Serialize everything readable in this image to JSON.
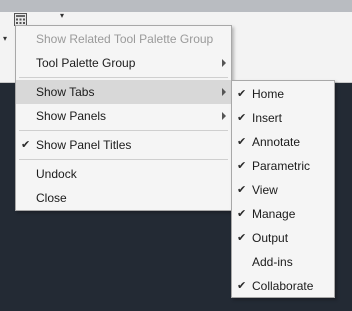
{
  "main_menu": {
    "items": [
      {
        "label": "Show Related Tool Palette Group",
        "disabled": true
      },
      {
        "label": "Tool Palette Group",
        "submenu": true
      },
      {
        "label": "Show Tabs",
        "submenu": true,
        "highlighted": true
      },
      {
        "label": "Show Panels",
        "submenu": true
      },
      {
        "label": "Show Panel Titles",
        "checked": true,
        "check": "✔"
      },
      {
        "label": "Undock"
      },
      {
        "label": "Close"
      }
    ]
  },
  "tabs_submenu": {
    "check_glyph": "✔",
    "items": [
      {
        "label": "Home",
        "checked": true
      },
      {
        "label": "Insert",
        "checked": true
      },
      {
        "label": "Annotate",
        "checked": true
      },
      {
        "label": "Parametric",
        "checked": true
      },
      {
        "label": "View",
        "checked": true
      },
      {
        "label": "Manage",
        "checked": true
      },
      {
        "label": "Output",
        "checked": true
      },
      {
        "label": "Add-ins",
        "checked": false
      },
      {
        "label": "Collaborate",
        "checked": true
      }
    ]
  },
  "colors": {
    "drawing_area": "#232a34",
    "ribbon": "#f3f3f3",
    "menu_bg": "#f5f5f5",
    "highlight": "#d8d8d8"
  },
  "icons": {
    "qat": "calculator-grid-icon",
    "dropdown": "dropdown-arrow-icon"
  }
}
